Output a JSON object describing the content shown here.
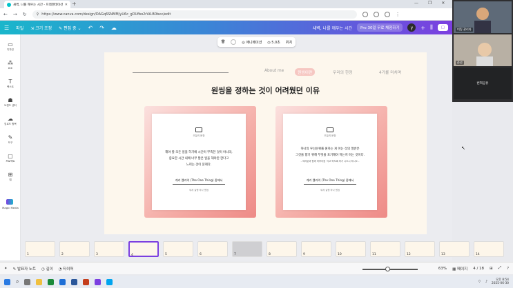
{
  "browser": {
    "tab_title": "새벽, 나를 깨우는 시간 - 프레젠테이션",
    "url": "https://www.canva.com/design/DAGq6SNMM/yU6c_gDUfbo2rVA-B0bxv/edit",
    "newtab": "+",
    "window_controls": [
      "—",
      "❐",
      "✕"
    ]
  },
  "canva_header": {
    "file": "파일",
    "resize": "크기 조정",
    "editing": "편집 중",
    "doc_title": "새벽, 나를 깨우는 시간",
    "pro": "Pro 30일 무료 체험하기",
    "avatar": "y",
    "share": "+"
  },
  "sidebar": [
    {
      "label": "디자인",
      "icon": "layout-icon",
      "glyph": "▭"
    },
    {
      "label": "요소",
      "icon": "elements-icon",
      "glyph": "⁂"
    },
    {
      "label": "텍스트",
      "icon": "text-icon",
      "glyph": "T"
    },
    {
      "label": "브랜드 센터",
      "icon": "brand-icon",
      "glyph": "☗"
    },
    {
      "label": "업로드 항목",
      "icon": "upload-icon",
      "glyph": "☁"
    },
    {
      "label": "도구",
      "icon": "tools-icon",
      "glyph": "✎"
    },
    {
      "label": "프로젝트",
      "icon": "folder-icon",
      "glyph": "▢"
    },
    {
      "label": "앱",
      "icon": "apps-icon",
      "glyph": "⊞"
    }
  ],
  "magic_media": "Magic Media",
  "toolbar": {
    "animate": "애니메이션",
    "duration": "5.0초",
    "position": "위치"
  },
  "slide": {
    "nav": [
      "About me",
      "원씽이란",
      "우리의 한정",
      "4가를 미치며"
    ],
    "title": "원씽을 정하는 것이 어려웠던 이유",
    "cards": [
      {
        "caption": "오늘의 문장",
        "lines": [
          "해야 할 모든 일을 하기에 시간이 부족한 것이 아니라,",
          "중요한 시간 내에 너무 많은 일을 해야만 한다고",
          "느끼는 것이 문제다."
        ],
        "source": "게리 켈러의 (The One Thing) 중에서",
        "sub": "세계 실행 하나 원씽"
      },
      {
        "caption": "오늘의 문장",
        "lines": [
          "하나의 우선순위를 원하는 게 아는 것의 절반은",
          "그것을 향기 위해 무엇을 포기해야 하는지 아는 것이다.",
          "- 여러분과 함께 하루아침 '사고'하도록 하기 시도시 하시도 -"
        ],
        "source": "게리 켈러의 (The One Thing) 중에서",
        "sub": "세계 실행 하나 원씽"
      }
    ]
  },
  "thumbnails": [
    "1",
    "2",
    "3",
    "4",
    "5",
    "6",
    "7",
    "8",
    "9",
    "10",
    "11",
    "12",
    "13",
    "14"
  ],
  "bottom": {
    "notes": "발표자 노트",
    "duration": "길이",
    "timer": "타이머",
    "zoom": "63%",
    "pages_label": "페이지",
    "page_count": "4 / 18"
  },
  "video": {
    "p1": "미팅 관리자",
    "p2": "준선",
    "p3": "번역공유"
  },
  "clock": {
    "time": "오후 8:54",
    "date": "2025-06-30"
  }
}
